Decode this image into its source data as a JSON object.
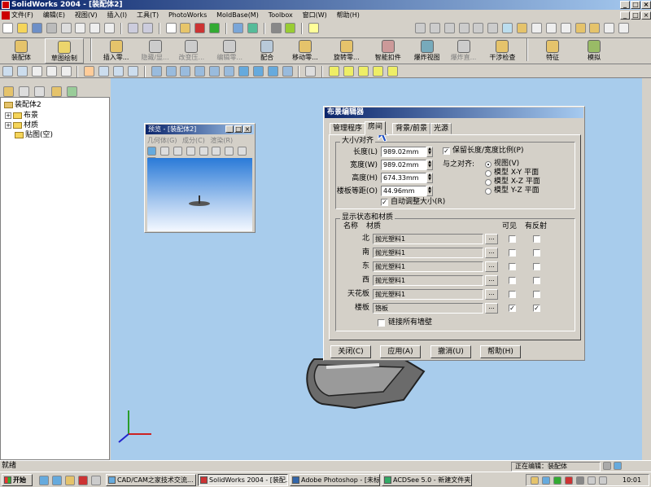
{
  "window": {
    "title": "SolidWorks 2004 - [装配体2]",
    "buttons": [
      "_",
      "□",
      "×"
    ]
  },
  "menu": {
    "items": [
      "文件(F)",
      "编辑(E)",
      "视图(V)",
      "插入(I)",
      "工具(T)",
      "PhotoWorks",
      "MoldBase(M)",
      "Toolbox",
      "窗口(W)",
      "帮助(H)"
    ]
  },
  "commandmanager": {
    "assembly_label": "装配体",
    "sketch_label": "草图绘制",
    "buttons": [
      {
        "label": "插入零..."
      },
      {
        "label": "隐藏/显..."
      },
      {
        "label": "改变压..."
      },
      {
        "label": "编辑零..."
      },
      {
        "label": "配合"
      },
      {
        "label": "移动零..."
      },
      {
        "label": "旋转零..."
      },
      {
        "label": "智能扣件"
      },
      {
        "label": "爆炸视图"
      },
      {
        "label": "爆炸直..."
      },
      {
        "label": "干涉检查"
      },
      {
        "label": "特征"
      },
      {
        "label": "模拟"
      }
    ]
  },
  "tree": {
    "root": "装配体2",
    "items": [
      "布景",
      "材质",
      "贴图(空)"
    ]
  },
  "preview": {
    "title": "预览 - [装配体2]",
    "menu": [
      "几何体(G)",
      "成分(C)",
      "渲染(R)"
    ]
  },
  "dialog": {
    "title": "布景编辑器",
    "tabs": [
      "管理程序",
      "房间",
      "背景/前景",
      "光源"
    ],
    "size_group": {
      "label": "大小/对齐",
      "fields": [
        {
          "label": "长度(L)",
          "value": "989.02mm"
        },
        {
          "label": "宽度(W)",
          "value": "989.02mm"
        },
        {
          "label": "高度(H)",
          "value": "674.33mm"
        },
        {
          "label": "楼板等距(O)",
          "value": "44.96mm"
        }
      ],
      "keep_ratio": "保留长度/宽度比例(P)",
      "keep_ratio_checked": true,
      "auto_resize": "自动调整大小(R)",
      "auto_resize_checked": true,
      "align_label": "与之对齐:",
      "align_options": [
        "视图(V)",
        "模型 X-Y 平面",
        "模型 X-Z 平面",
        "模型 Y-Z 平面"
      ],
      "align_selected": 0
    },
    "display_group": {
      "label": "显示状态和材质",
      "headers": {
        "name": "名称",
        "material": "材质",
        "visible": "可见",
        "reflective": "有反射"
      },
      "rows": [
        {
          "name": "北",
          "material": "抛光塑料1",
          "visible": false,
          "reflective": false
        },
        {
          "name": "南",
          "material": "抛光塑料1",
          "visible": false,
          "reflective": false
        },
        {
          "name": "东",
          "material": "抛光塑料1",
          "visible": false,
          "reflective": false
        },
        {
          "name": "西",
          "material": "抛光塑料1",
          "visible": false,
          "reflective": false
        },
        {
          "name": "天花板",
          "material": "抛光塑料1",
          "visible": false,
          "reflective": false
        },
        {
          "name": "楼板",
          "material": "铬板",
          "visible": true,
          "reflective": true
        }
      ],
      "ellipsis": "...",
      "link_walls": "链接所有墙壁",
      "link_walls_checked": false
    },
    "buttons": {
      "close": "关闭(C)",
      "apply": "应用(A)",
      "cancel": "撤消(U)",
      "help": "帮助(H)"
    }
  },
  "statusbar": {
    "left": "就绪",
    "right": "正在编辑：装配体"
  },
  "taskbar": {
    "start": "开始",
    "tasks": [
      "CAD/CAM之家技术交流...",
      "SolidWorks 2004 - [装配...",
      "Adobe Photoshop - [未标...",
      "ACDSee 5.0 - 新建文件夹"
    ],
    "clock": "10:01"
  },
  "colors": {
    "titlebar": "#0a246a",
    "viewport": "#a8ccec",
    "face": "#d4d0c8"
  }
}
